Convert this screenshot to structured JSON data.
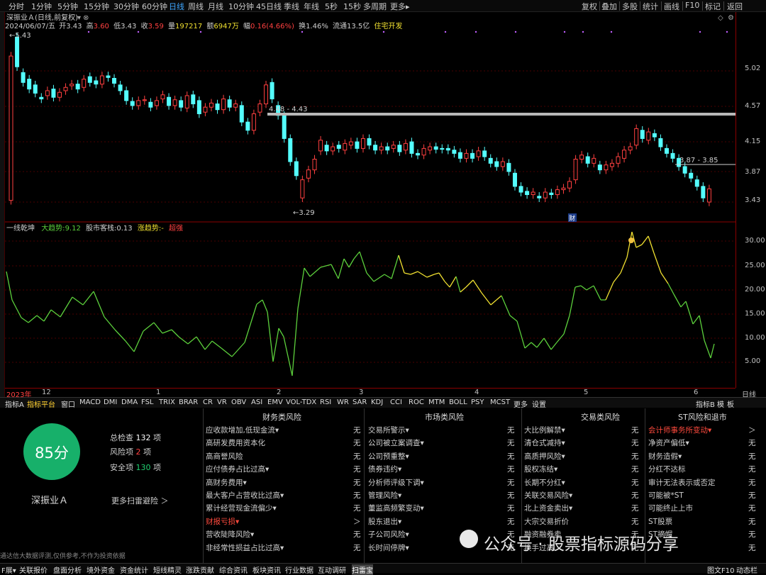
{
  "toolbar": {
    "periods": [
      "分时",
      "1分钟",
      "5分钟",
      "15分钟",
      "30分钟",
      "60分钟",
      "日线",
      "周线",
      "月线",
      "10分钟",
      "45日线",
      "季线",
      "年线",
      "5秒",
      "15秒",
      "多周期",
      "更多▸"
    ],
    "active": 6,
    "right": [
      "复权",
      "叠加",
      "多股",
      "统计",
      "画线",
      "F10",
      "标记",
      "返回"
    ]
  },
  "quote": {
    "title": "深振业Ａ(日线,前复权)",
    "date": "2024/06/07/五",
    "open_l": "开",
    "open": "3.43",
    "high_l": "高",
    "high": "3.60",
    "low_l": "低",
    "low": "3.43",
    "close_l": "收",
    "close": "3.59",
    "vol_l": "量",
    "vol": "197217",
    "amt_l": "额",
    "amt": "6947万",
    "chg_l": "幅",
    "chg": "0.16(4.66%)",
    "turn_l": "换",
    "turn": "1.46%",
    "float_l": "流通",
    "float": "13.5亿",
    "sector": "住宅开发"
  },
  "main_chart": {
    "yaxis": [
      "5.02",
      "4.57",
      "4.15",
      "3.87",
      "3.43"
    ],
    "ann_high": "5.43",
    "ann_low": "3.29",
    "line1": "4.48 - 4.43",
    "line2": "3.87 - 3.85",
    "cai": "财"
  },
  "ind": {
    "name": "一线乾坤",
    "t1_l": "大趋势:",
    "t1": "9.12",
    "t2_l": "股市客栈:",
    "t2": "0.13",
    "t3_l": "涨趋势:",
    "t3": "-",
    "t4": "超强",
    "yaxis": [
      "30.00",
      "25.00",
      "20.00",
      "15.00",
      "10.00",
      "5.00"
    ]
  },
  "dates": [
    "2023年",
    "12",
    "1",
    "2",
    "3",
    "4",
    "5",
    "6"
  ],
  "axis_label": "日线",
  "tabs": [
    "指标A",
    "指标平台",
    "窗口",
    "MACD",
    "DMI",
    "DMA",
    "FSL",
    "TRIX",
    "BRAR",
    "CR",
    "VR",
    "OBV",
    "ASI",
    "EMV",
    "VOL-TDX",
    "RSI",
    "WR",
    "SAR",
    "KDJ",
    "CCI",
    "ROC",
    "MTM",
    "BOLL",
    "PSY",
    "MCST",
    "更多",
    "设置"
  ],
  "tabs_right": [
    "指标B",
    "模",
    "板"
  ],
  "risk": {
    "score": "85分",
    "name": "深振业Ａ",
    "stats": [
      {
        "l": "总检查",
        "v": "132",
        "u": "项"
      },
      {
        "l": "风险项",
        "v": "2",
        "u": "项"
      },
      {
        "l": "安全项",
        "v": "130",
        "u": "项"
      }
    ],
    "more": "更多扫雷避险 ＞",
    "disclaimer": "通达信大数据评测,仅供参考,不作为投资依据",
    "cols": [
      {
        "title": "财务类风险",
        "rows": [
          {
            "l": "应收款增加,低现金流▾",
            "v": "无"
          },
          {
            "l": "高研发费用资本化",
            "v": "无"
          },
          {
            "l": "高商誉风险",
            "v": "无"
          },
          {
            "l": "应付债券占比过高▾",
            "v": "无"
          },
          {
            "l": "高财务费用▾",
            "v": "无"
          },
          {
            "l": "最大客户占营收比过高▾",
            "v": "无"
          },
          {
            "l": "累计经营现金流偏少▾",
            "v": "无"
          },
          {
            "l": "财报亏损▾",
            "v": "＞",
            "red": true
          },
          {
            "l": "营收陡降风险▾",
            "v": "无"
          },
          {
            "l": "非经常性损益占比过高▾",
            "v": "无"
          }
        ]
      },
      {
        "title": "市场类风险",
        "rows": [
          {
            "l": "交易所警示▾",
            "v": "无"
          },
          {
            "l": "公司被立案调查▾",
            "v": "无"
          },
          {
            "l": "公司预重整▾",
            "v": "无"
          },
          {
            "l": "债券违约▾",
            "v": "无"
          },
          {
            "l": "分析师评级下调▾",
            "v": "无"
          },
          {
            "l": "管理风险▾",
            "v": "无"
          },
          {
            "l": "董监高频繁变动▾",
            "v": "无"
          },
          {
            "l": "股东退出▾",
            "v": "无"
          },
          {
            "l": "子公司风险▾",
            "v": "无"
          },
          {
            "l": "长时间停牌▾",
            "v": "无"
          }
        ]
      },
      {
        "title": "交易类风险",
        "rows": [
          {
            "l": "大比例解禁▾",
            "v": "无"
          },
          {
            "l": "清仓式减持▾",
            "v": "无"
          },
          {
            "l": "高质押风险▾",
            "v": "无"
          },
          {
            "l": "股权冻结▾",
            "v": "无"
          },
          {
            "l": "长期不分红▾",
            "v": "无"
          },
          {
            "l": "关联交易风险▾",
            "v": "无"
          },
          {
            "l": "北上资金卖出▾",
            "v": "无"
          },
          {
            "l": "大宗交易折价",
            "v": "无"
          },
          {
            "l": "融资融券卖",
            "v": "无"
          },
          {
            "l": "换手过高",
            "v": "无"
          }
        ]
      },
      {
        "title": "ST风险和退市",
        "rows": [
          {
            "l": "会计师事务所变动▾",
            "v": "＞",
            "red": true
          },
          {
            "l": "净资产偏低▾",
            "v": "无"
          },
          {
            "l": "财务造假▾",
            "v": "无"
          },
          {
            "l": "分红不达标",
            "v": "无"
          },
          {
            "l": "审计无法表示或否定",
            "v": "无"
          },
          {
            "l": "可能被*ST",
            "v": "无"
          },
          {
            "l": "可能终止上市",
            "v": "无"
          },
          {
            "l": "ST股票",
            "v": "无"
          },
          {
            "l": "ST摘帽",
            "v": "无"
          },
          {
            "l": "",
            "v": "无"
          }
        ]
      }
    ]
  },
  "watermark": "公众号 · 股票指标源码分享",
  "bottom": [
    "F展▾",
    "关联报价",
    "盘面分析",
    "境外资金",
    "资金统计",
    "短线精灵",
    "涨跌贡献",
    "综合资讯",
    "板块资讯",
    "行业数据",
    "互动调研",
    "扫雷宝"
  ],
  "bottom_right": [
    "图文F10",
    "动态栏"
  ],
  "colors": {
    "up": "#ff4040",
    "down": "#54ffff",
    "line_green": "#5cd03c",
    "line_yellow": "#f0e030",
    "panel_green": "#17b06a"
  }
}
